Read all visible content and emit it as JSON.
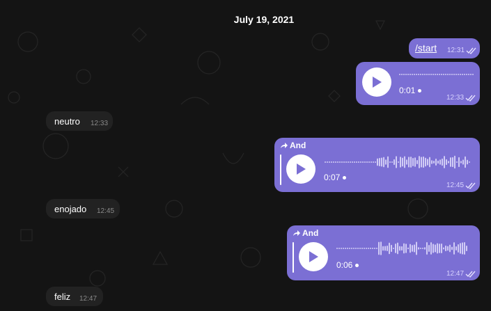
{
  "date_label": "July 19, 2021",
  "messages": {
    "start": {
      "text": "/start",
      "time": "12:31"
    },
    "voice1": {
      "duration": "0:01",
      "time": "12:33"
    },
    "neutro": {
      "text": "neutro",
      "time": "12:33"
    },
    "voice2": {
      "forwarded_from": "And",
      "duration": "0:07",
      "time": "12:45"
    },
    "enojado": {
      "text": "enojado",
      "time": "12:45"
    },
    "voice3": {
      "forwarded_from": "And",
      "duration": "0:06",
      "time": "12:47"
    },
    "feliz": {
      "text": "feliz",
      "time": "12:47"
    }
  },
  "icons": {
    "play": "play-icon",
    "read_receipt": "double-check-icon",
    "forward": "forward-arrow-icon"
  },
  "colors": {
    "outgoing_bubble": "#7b6fd4",
    "incoming_bubble": "#222222",
    "background": "#141414"
  }
}
